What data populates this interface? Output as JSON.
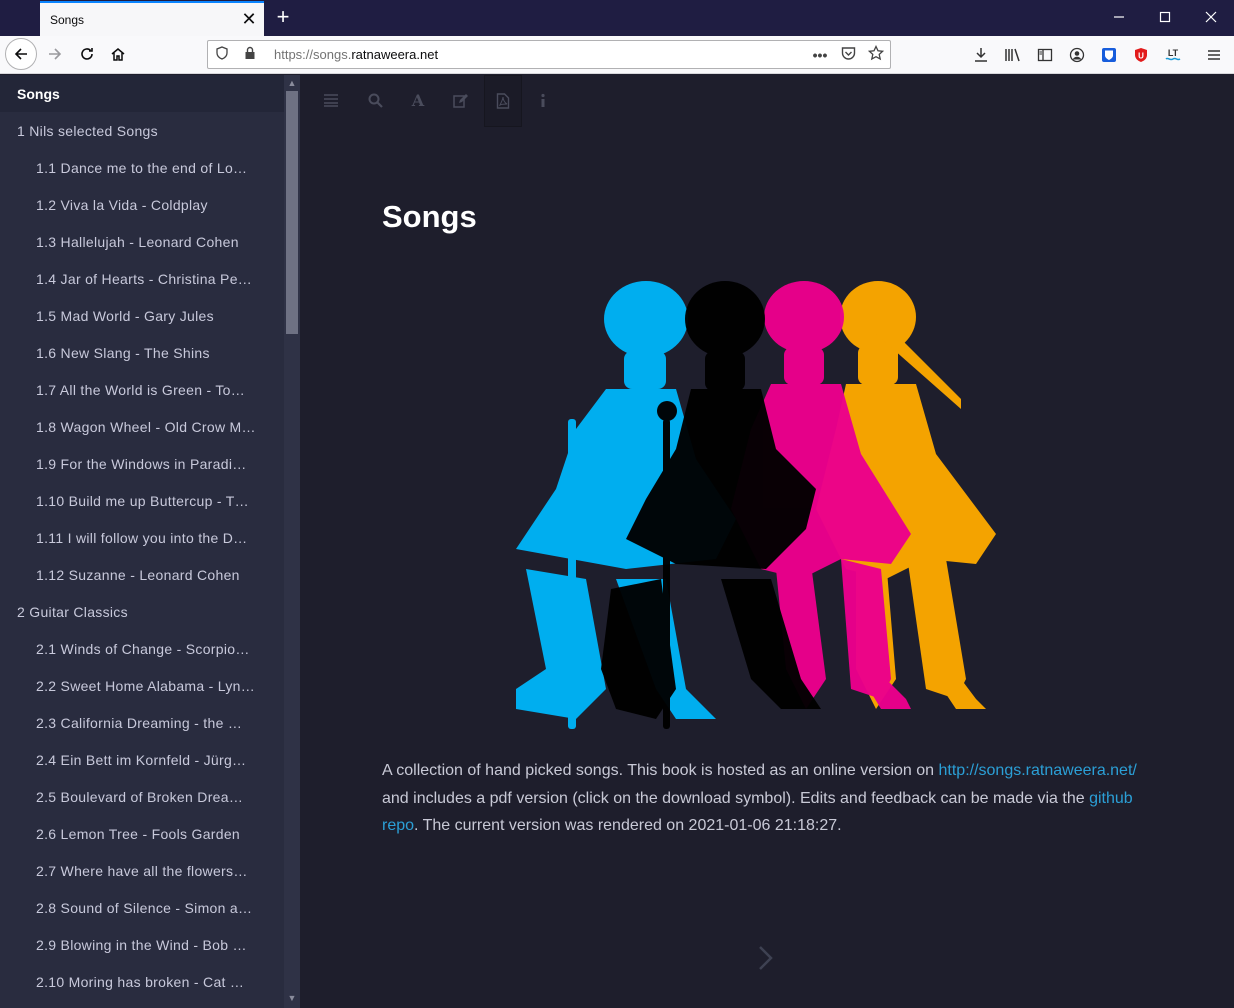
{
  "browser": {
    "tab_title": "Songs",
    "url_prefix": "https://songs.",
    "url_domain": "ratnaweera.net"
  },
  "sidebar": {
    "title": "Songs",
    "chapters": [
      {
        "label": "1 Nils selected Songs",
        "items": [
          "1.1 Dance me to the end of Lo…",
          "1.2 Viva la Vida - Coldplay",
          "1.3 Hallelujah - Leonard Cohen",
          "1.4 Jar of Hearts - Christina Pe…",
          "1.5 Mad World - Gary Jules",
          "1.6 New Slang - The Shins",
          "1.7 All the World is Green - To…",
          "1.8 Wagon Wheel - Old Crow M…",
          "1.9 For the Windows in Paradi…",
          "1.10 Build me up Buttercup - T…",
          "1.11 I will follow you into the D…",
          "1.12 Suzanne - Leonard Cohen"
        ]
      },
      {
        "label": "2 Guitar Classics",
        "items": [
          "2.1 Winds of Change - Scorpio…",
          "2.2 Sweet Home Alabama - Lyn…",
          "2.3 California Dreaming - the …",
          "2.4 Ein Bett im Kornfeld - Jürg…",
          "2.5 Boulevard of Broken Drea…",
          "2.6 Lemon Tree - Fools Garden",
          "2.7 Where have all the flowers…",
          "2.8 Sound of Silence - Simon a…",
          "2.9 Blowing in the Wind - Bob …",
          "2.10 Moring has broken - Cat …"
        ]
      }
    ]
  },
  "content": {
    "title": "Songs",
    "intro": {
      "text1": "A collection of hand picked songs. This book is hosted as an online version on ",
      "link1": "http://songs.ratnaweera.net/",
      "text2": " and includes a pdf version (click on the download symbol). Edits and feedback can be made via the ",
      "link2": "github repo",
      "text3": ". The current version was rendered on 2021-01-06 21:18:27."
    }
  },
  "colors": {
    "sidebar_bg": "#292c3f",
    "content_bg": "#1e1e2c",
    "link": "#2b9fd6",
    "cyan": "#00aeef",
    "magenta": "#ec008c",
    "yellow": "#f4a300",
    "black": "#000000"
  }
}
